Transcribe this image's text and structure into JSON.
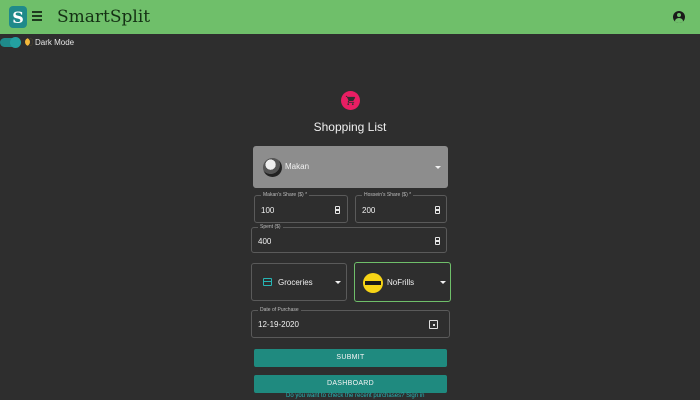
{
  "header": {
    "logo_letter": "S",
    "app_title": "SmartSplit",
    "menu_icon": "hamburger-menu-icon",
    "account_icon": "account-circle-icon",
    "accent_color": "#6fbf6a"
  },
  "theme": {
    "dark_mode_label": "Dark Mode",
    "dark_mode_on": true
  },
  "page": {
    "title": "Shopping List",
    "icon": "shopping-cart-icon",
    "icon_color": "#e91e63"
  },
  "form": {
    "payer": {
      "selected": "Makan"
    },
    "makan_share": {
      "label": "Makan's Share ($) *",
      "value": "100"
    },
    "hossein_share": {
      "label": "Hossein's Share ($) *",
      "value": "200"
    },
    "spent": {
      "label": "Spent ($)",
      "value": "400"
    },
    "category": {
      "selected": "Groceries",
      "icon": "credit-card-icon"
    },
    "store": {
      "selected": "NoFrills",
      "logo_text": "no frills"
    },
    "date": {
      "label": "Date of Purchase",
      "value": "12-19-2020",
      "icon": "calendar-icon"
    },
    "submit_label": "SUBMIT",
    "dashboard_label": "DASHBOARD",
    "recent_link": "Do you want to check the recent purchases? Sign in"
  },
  "colors": {
    "primary_button": "#1f8a7f",
    "background": "#2e2e2e"
  }
}
